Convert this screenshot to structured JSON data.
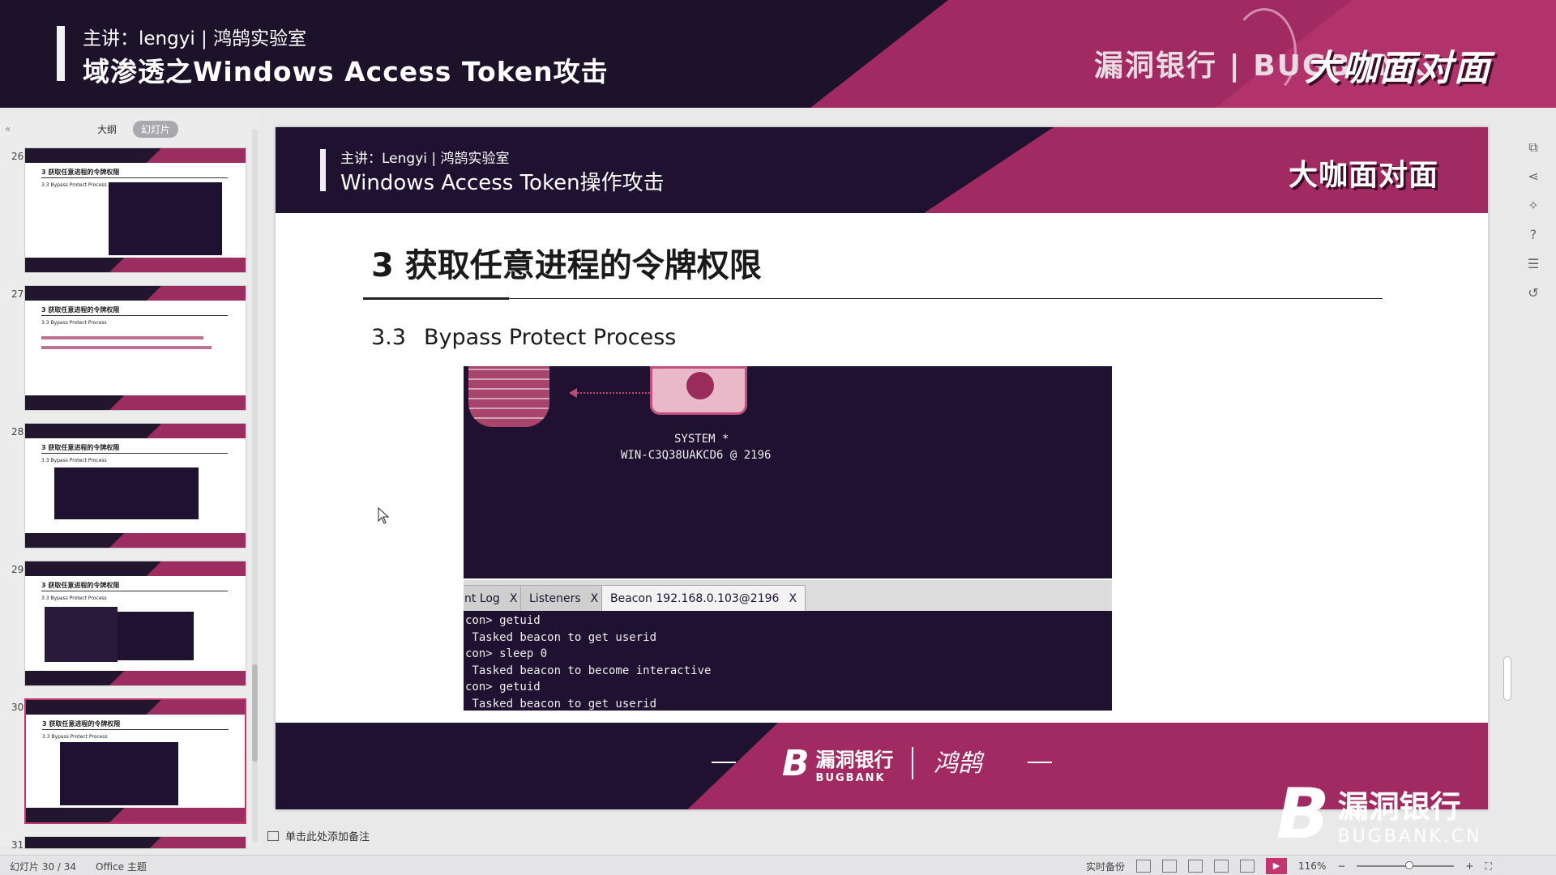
{
  "banner": {
    "presenter": "主讲：lengyi | 鸿鹄实验室",
    "title": "域渗透之Windows Access Token攻击",
    "brand": "漏洞银行 | BUGBANK",
    "badge": "大咖面对面"
  },
  "leftpanel": {
    "collapse": "«",
    "tabs": [
      {
        "label": "大纲",
        "active": false
      },
      {
        "label": "幻灯片",
        "active": true
      }
    ],
    "thumbnails": [
      {
        "num": "26",
        "title": "3 获取任意进程的令牌权限",
        "sub": "3.3  Bypass Protect  Process"
      },
      {
        "num": "27",
        "title": "3 获取任意进程的令牌权限",
        "sub": "3.3  Bypass Protect  Process"
      },
      {
        "num": "28",
        "title": "3 获取任意进程的令牌权限",
        "sub": "3.3  Bypass Protect  Process"
      },
      {
        "num": "29",
        "title": "3 获取任意进程的令牌权限",
        "sub": "3.3  Bypass Protect  Process"
      },
      {
        "num": "30",
        "title": "3 获取任意进程的令牌权限",
        "sub": "3.3  Bypass Protect  Process"
      },
      {
        "num": "31",
        "title": "",
        "sub": ""
      }
    ]
  },
  "slide": {
    "presenter": "主讲：Lengyi | 鸿鹄实验室",
    "title": "Windows Access Token操作攻击",
    "badge": "大咖面对面",
    "heading": "3 获取任意进程的令牌权限",
    "subheading_num": "3.3",
    "subheading": "Bypass Protect  Process",
    "screenshot": {
      "system_label": "SYSTEM *",
      "host_label": "WIN-C3Q38UAKCD6 @ 2196",
      "tabs": [
        {
          "label": "nt Log",
          "close": "X"
        },
        {
          "label": "Listeners",
          "close": "X"
        },
        {
          "label": "Beacon 192.168.0.103@2196",
          "close": "X",
          "active": true
        }
      ],
      "console_lines": [
        "con> getuid",
        " Tasked beacon to get userid",
        "con> sleep 0",
        " Tasked beacon to become interactive",
        "con> getuid",
        " Tasked beacon to get userid"
      ]
    },
    "footer": {
      "logo_cn": "漏洞银行",
      "logo_en": "BUGBANK",
      "logo_mark": "B",
      "signature": "鸿鹄"
    }
  },
  "watermark": {
    "mark": "B",
    "cn": "漏洞银行",
    "en": "BUGBANK.CN"
  },
  "notes_placeholder": "单击此处添加备注",
  "status": {
    "slide_counter": "幻灯片 30 / 34",
    "theme": "Office 主题",
    "backup": "实时备份",
    "zoom": "116%"
  },
  "colors": {
    "accent": "#a22a62",
    "dark": "#1f1230"
  }
}
